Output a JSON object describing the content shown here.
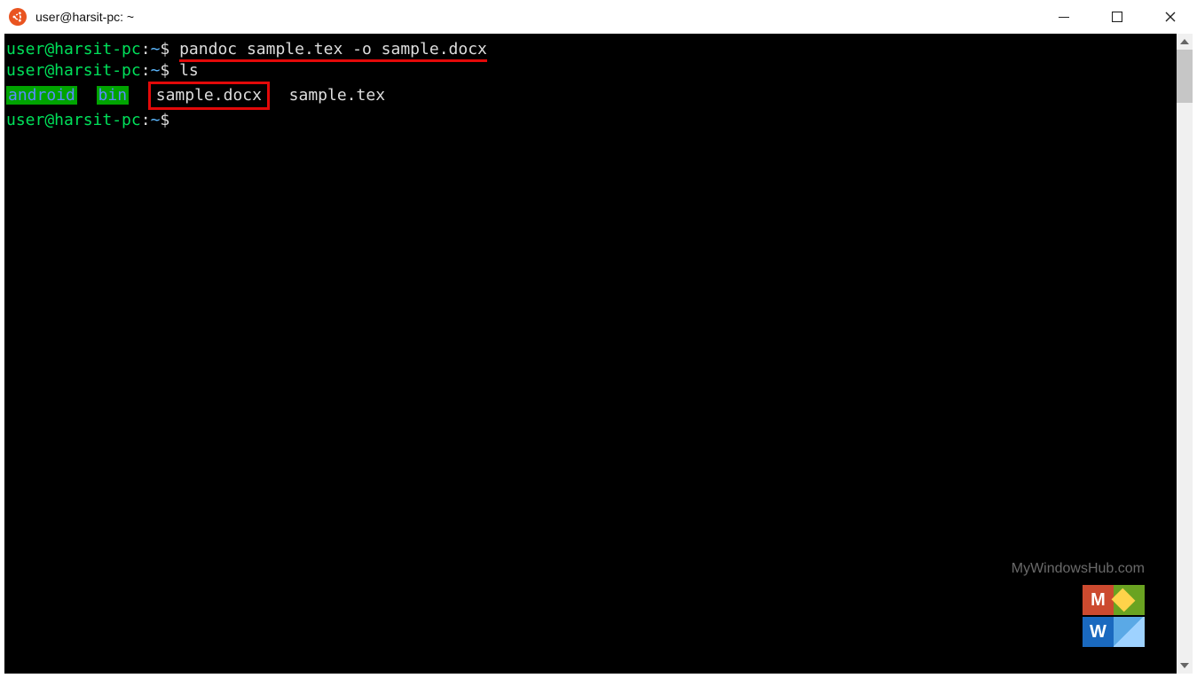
{
  "window": {
    "title": "user@harsit-pc: ~"
  },
  "prompt": {
    "user_host": "user@harsit-pc",
    "colon": ":",
    "path": "~",
    "symbol": "$"
  },
  "lines": {
    "cmd1": "pandoc sample.tex -o sample.docx",
    "cmd2": "ls",
    "ls": {
      "dir1": "android",
      "dir2": "bin",
      "file1": "sample.docx",
      "file2": "sample.tex"
    },
    "cmd3": ""
  },
  "annotations": {
    "underline_target": "pandoc sample.tex -o sample.docx",
    "box_target": "sample.docx"
  },
  "watermark": {
    "text": "MyWindowsHub.com",
    "top_letter": "M",
    "bottom_letter": "W"
  },
  "window_controls": {
    "minimize": "minimize",
    "maximize": "maximize",
    "close": "close"
  }
}
